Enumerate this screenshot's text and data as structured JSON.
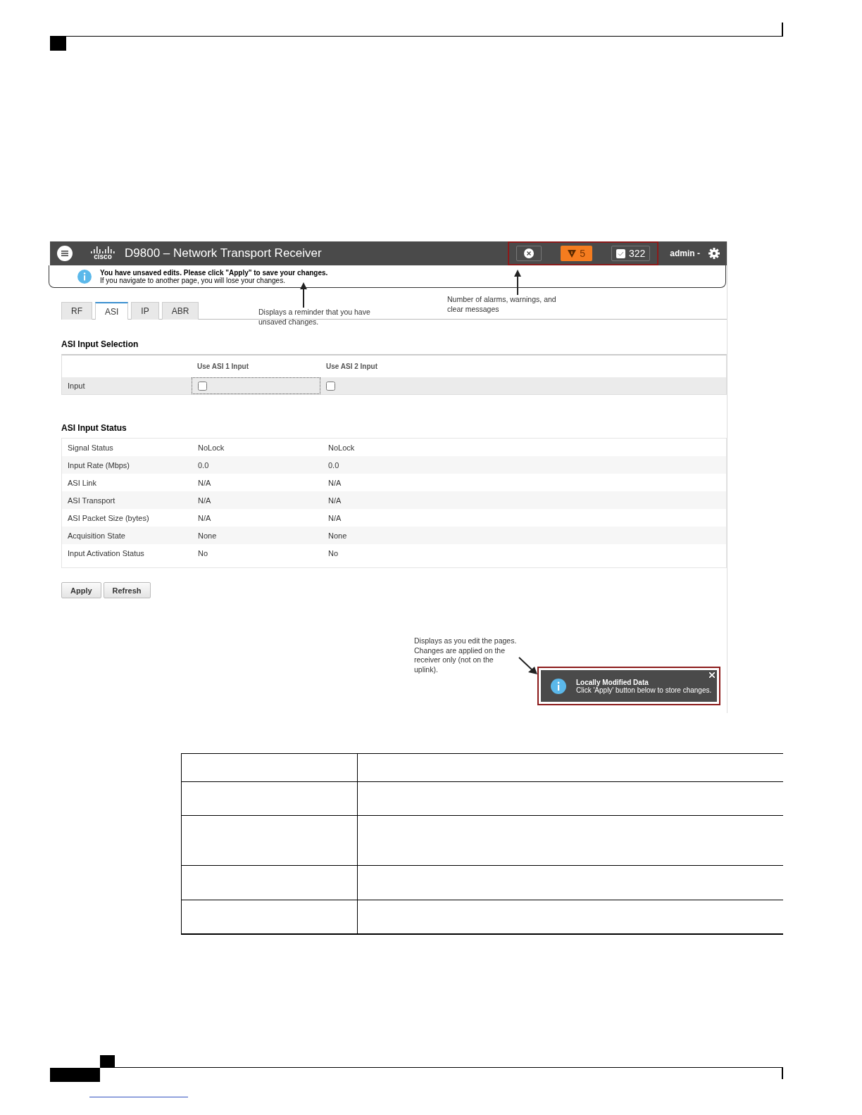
{
  "app": {
    "logo_text": "cisco",
    "title": "D9800 – Network Transport Receiver",
    "warning_count": "5",
    "clear_count": "322",
    "user": "admin -"
  },
  "banner": {
    "title": "You have unsaved edits. Please click \"Apply\" to save your changes.",
    "message": "If you navigate to another page, you will lose your changes."
  },
  "tabs": [
    {
      "label": "RF",
      "selected": false
    },
    {
      "label": "ASI",
      "selected": true
    },
    {
      "label": "IP",
      "selected": false
    },
    {
      "label": "ABR",
      "selected": false
    }
  ],
  "annotations": [
    "Displays a reminder that you have unsaved changes.",
    "Number of alarms, warnings, and clear messages",
    "Displays as you edit the pages. Changes are applied on the receiver only (not on the uplink)."
  ],
  "selection": {
    "heading": "ASI Input Selection",
    "columns": [
      "Use ASI 1 Input",
      "Use ASI 2 Input"
    ],
    "rows": [
      {
        "label": "Input",
        "checked": [
          false,
          false
        ]
      }
    ]
  },
  "status": {
    "heading": "ASI Input Status",
    "rows": [
      {
        "label": "Signal Status",
        "values": [
          "NoLock",
          "NoLock"
        ]
      },
      {
        "label": "Input Rate (Mbps)",
        "values": [
          "0.0",
          "0.0"
        ]
      },
      {
        "label": "ASI Link",
        "values": [
          "N/A",
          "N/A"
        ]
      },
      {
        "label": "ASI Transport",
        "values": [
          "N/A",
          "N/A"
        ]
      },
      {
        "label": "ASI Packet Size (bytes)",
        "values": [
          "N/A",
          "N/A"
        ]
      },
      {
        "label": "Acquisition State",
        "values": [
          "None",
          "None"
        ]
      },
      {
        "label": "Input Activation Status",
        "values": [
          "No",
          "No"
        ]
      }
    ]
  },
  "buttons": [
    "Apply",
    "Refresh"
  ],
  "toast": {
    "title": "Locally Modified Data",
    "message": "Click 'Apply' button below to store changes."
  }
}
